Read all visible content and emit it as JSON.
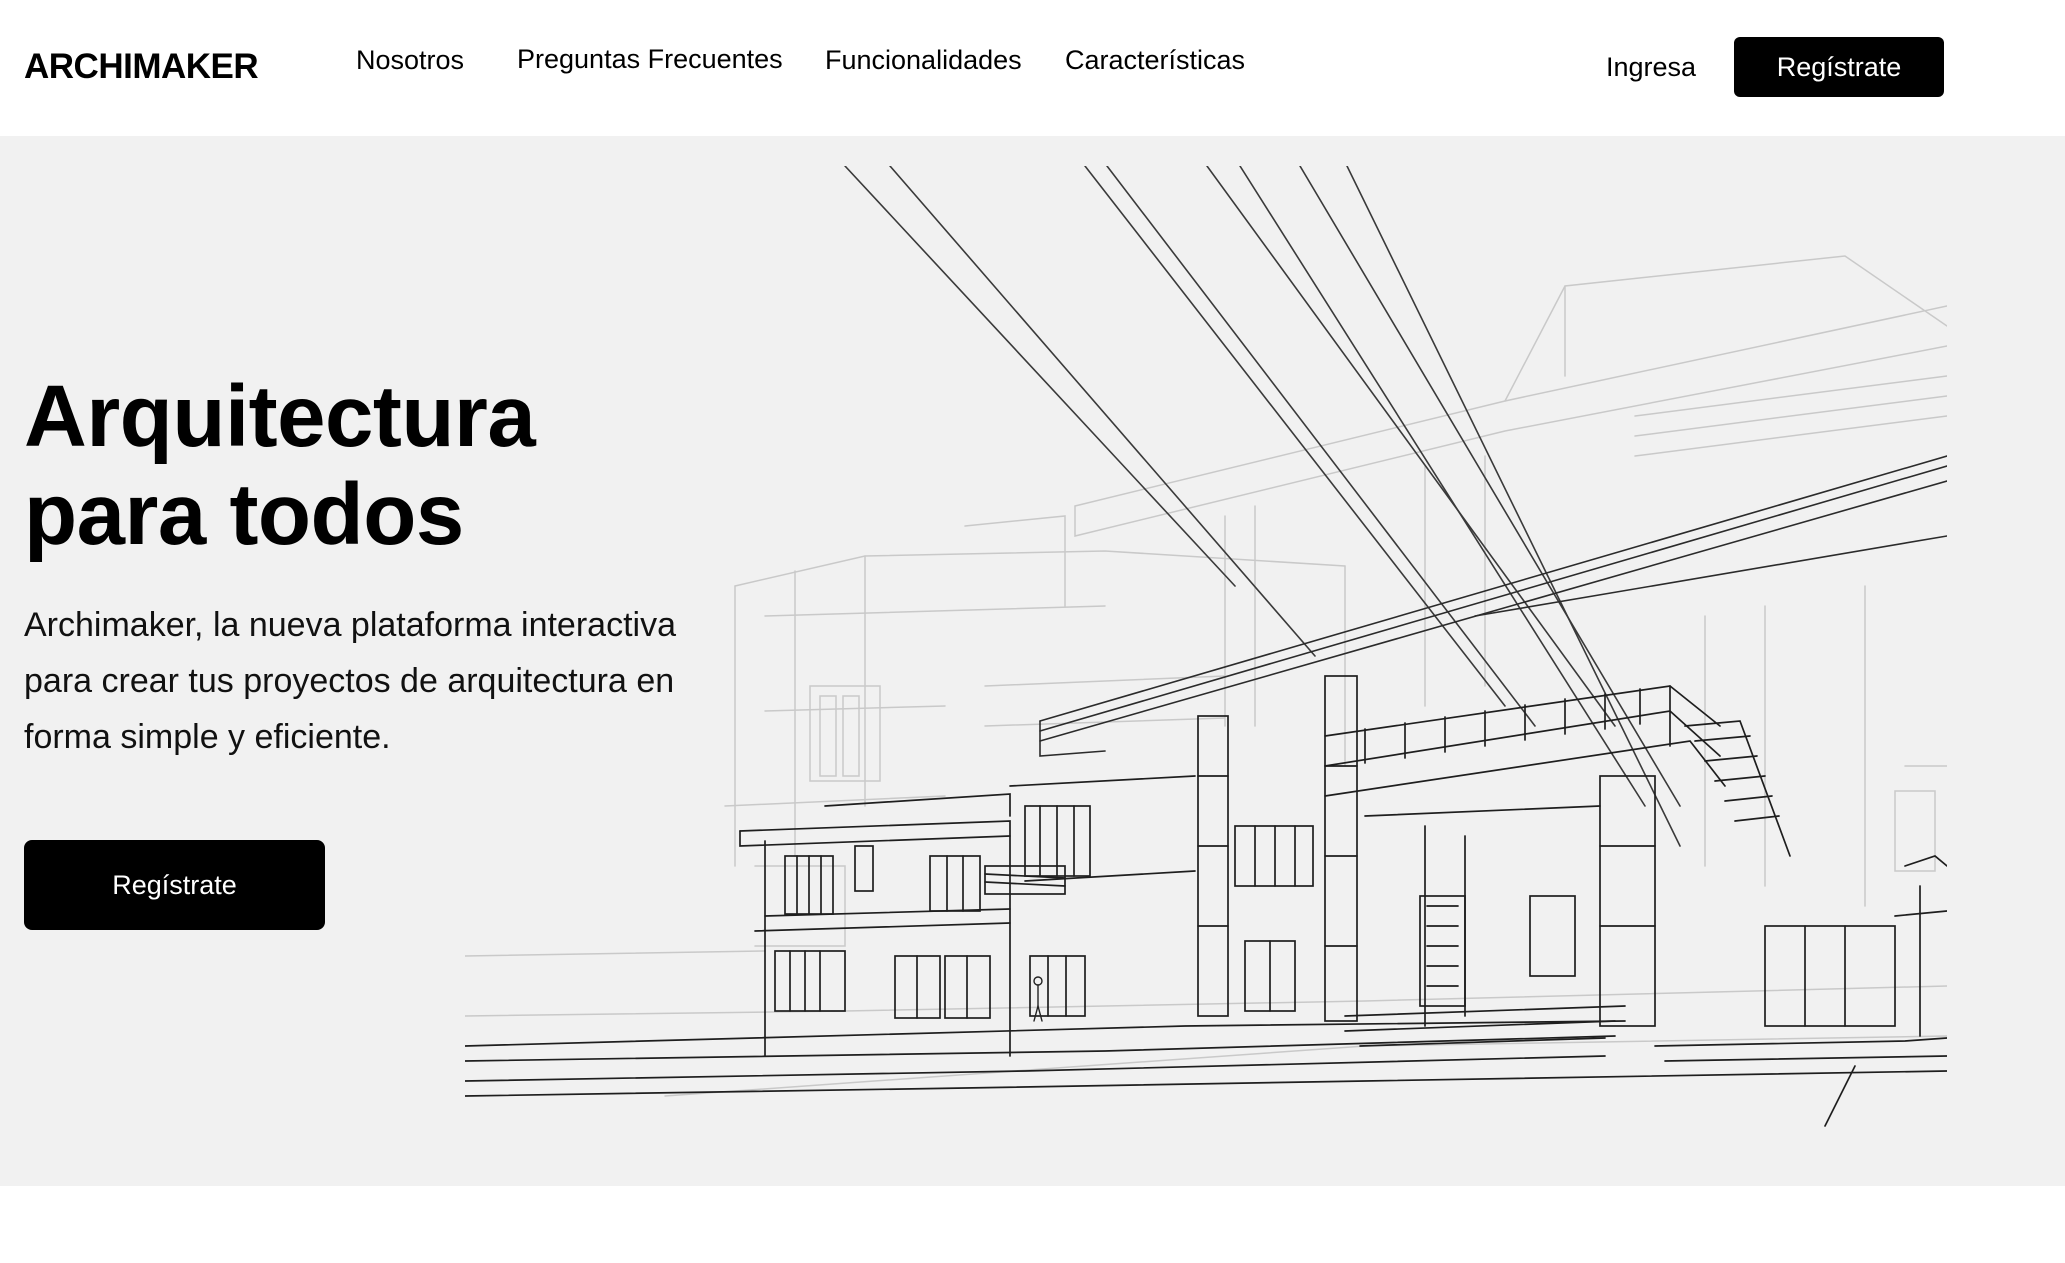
{
  "header": {
    "logo": "ARCHIMAKER",
    "nav": [
      {
        "label": "Nosotros"
      },
      {
        "label": "Preguntas Frecuentes"
      },
      {
        "label": "Funcionalidades"
      },
      {
        "label": "Características"
      }
    ],
    "login_label": "Ingresa",
    "register_label": "Regístrate"
  },
  "hero": {
    "title": "Arquitectura\npara todos",
    "description": "Archimaker, la nueva plataforma interactiva para crear tus proyectos de arquitectura en forma simple y eficiente.",
    "cta_label": "Regístrate",
    "illustration": "architectural-wireframe-house-drawing"
  },
  "colors": {
    "hero_background": "#f1f1f1",
    "button_background": "#000000",
    "button_text": "#ffffff"
  }
}
